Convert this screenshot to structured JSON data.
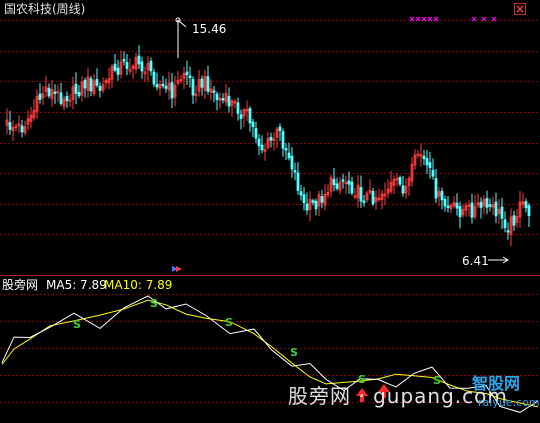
{
  "title": "国农科技(周线)",
  "price_panel": {
    "high_label": "15.46",
    "low_label": "6.41"
  },
  "indicator": {
    "name": "股旁网",
    "ma5": "MA5: 7.89",
    "ma10": "MA10: 7.89",
    "signal_letter": "S"
  },
  "watermark": {
    "text": "股旁网 · gupang.com",
    "logo_top": "智股网",
    "logo_bottom": "raiyue.com"
  },
  "chart_data": {
    "type": "candlestick",
    "high_marker": 15.46,
    "low_marker": 6.41,
    "ma5": 7.89,
    "ma10": 7.89
  },
  "colors": {
    "up": "#ff3c3c",
    "down": "#54ffff",
    "ma5_line": "#ffffff",
    "ma10_line": "#ffff00",
    "grid": "#8b0000",
    "signal": "#3ad13a",
    "arrow": "#ff2a2a",
    "magenta": "#ff00ff"
  },
  "icons": {
    "window_control": "close-icon",
    "arrow_marker": "up-arrow-icon"
  }
}
